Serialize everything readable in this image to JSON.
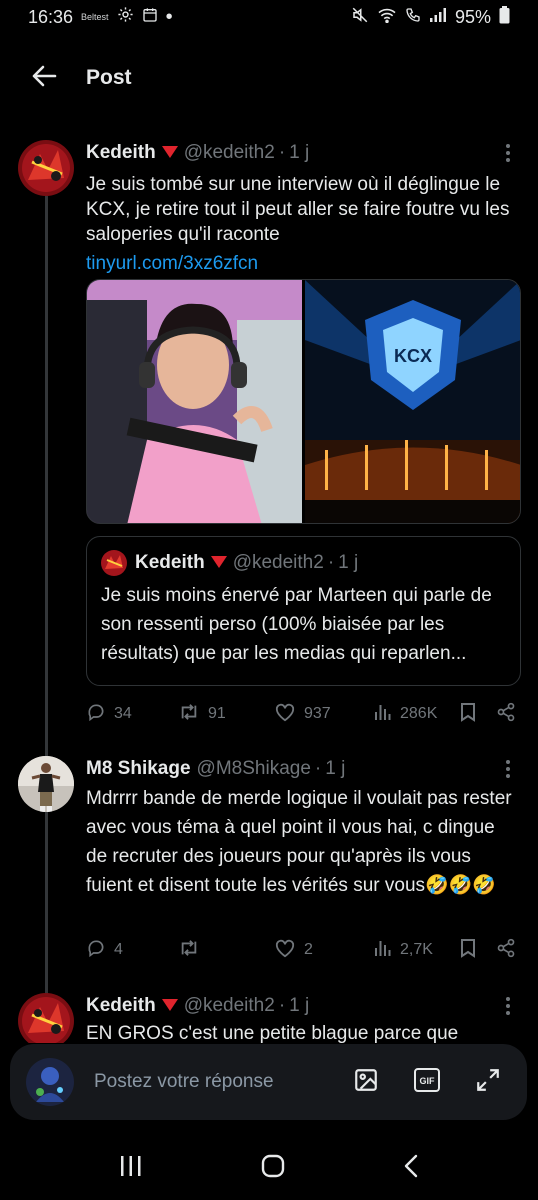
{
  "status_bar": {
    "time": "16:36",
    "small_text": "Beltest",
    "battery": "95%"
  },
  "header": {
    "title": "Post"
  },
  "tweets": [
    {
      "name": "Kedeith",
      "handle": "@kedeith2",
      "time": "1 j",
      "text": "Je suis tombé sur une interview où il déglingue le KCX, je retire tout il peut aller se faire foutre vu les saloperies qu'il raconte",
      "link": "tinyurl.com/3xz6zfcn",
      "quote": {
        "name": "Kedeith",
        "handle": "@kedeith2",
        "time": "1 j",
        "text": "Je suis moins énervé par Marteen qui parle de son ressenti perso (100% biaisée par les résultats) que par les medias qui reparlen..."
      },
      "stats": {
        "replies": "34",
        "reposts": "91",
        "likes": "937",
        "views": "286K"
      }
    },
    {
      "name": "M8 Shikage",
      "handle": "@M8Shikage",
      "time": "1 j",
      "text": "Mdrrrr bande de merde logique il voulait pas rester avec vous téma à quel point il vous hai, c dingue de recruter des joueurs pour qu'après ils vous fuient et disent toute les vérités sur vous🤣🤣🤣",
      "stats": {
        "replies": "4",
        "reposts": "",
        "likes": "2",
        "views": "2,7K"
      }
    },
    {
      "name": "Kedeith",
      "handle": "@kedeith2",
      "time": "1 j",
      "text": "EN GROS c'est une petite blague parce que"
    }
  ],
  "reply_bar": {
    "placeholder": "Postez votre réponse"
  },
  "icons": {
    "back": "arrow-left-icon",
    "more": "more-vertical-icon",
    "reply": "reply-icon",
    "repost": "repost-icon",
    "like": "heart-icon",
    "views": "views-icon",
    "bookmark": "bookmark-icon",
    "share": "share-icon"
  },
  "colors": {
    "background": "#000000",
    "text": "#e7e9ea",
    "muted": "#71767b",
    "link": "#1d9bf0",
    "border": "#2f3336"
  }
}
